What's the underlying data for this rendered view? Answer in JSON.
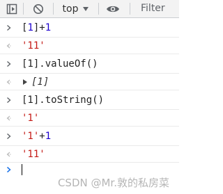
{
  "toolbar": {
    "context_label": "top",
    "filter_placeholder": "Filter"
  },
  "colors": {
    "string": "#c41a16",
    "number": "#1c00cf",
    "prompt_active": "#1a73e8"
  },
  "console": {
    "entries": [
      {
        "type": "input",
        "parts": [
          "[1]+1"
        ]
      },
      {
        "type": "output",
        "text": "'11'"
      },
      {
        "type": "input",
        "text": "[1].valueOf()"
      },
      {
        "type": "output-object",
        "text": "[1]"
      },
      {
        "type": "input",
        "text": "[1].toString()"
      },
      {
        "type": "output",
        "text": "'1'"
      },
      {
        "type": "input",
        "text": "'1'+1"
      },
      {
        "type": "output",
        "text": "'11'"
      }
    ],
    "input1_open": "[",
    "input1_num1": "1",
    "input1_mid": "]+",
    "input1_num2": "1",
    "input3_open": "'1'",
    "input3_plus": "+",
    "input3_num": "1"
  },
  "watermark": "CSDN @Mr.敦的私房菜"
}
